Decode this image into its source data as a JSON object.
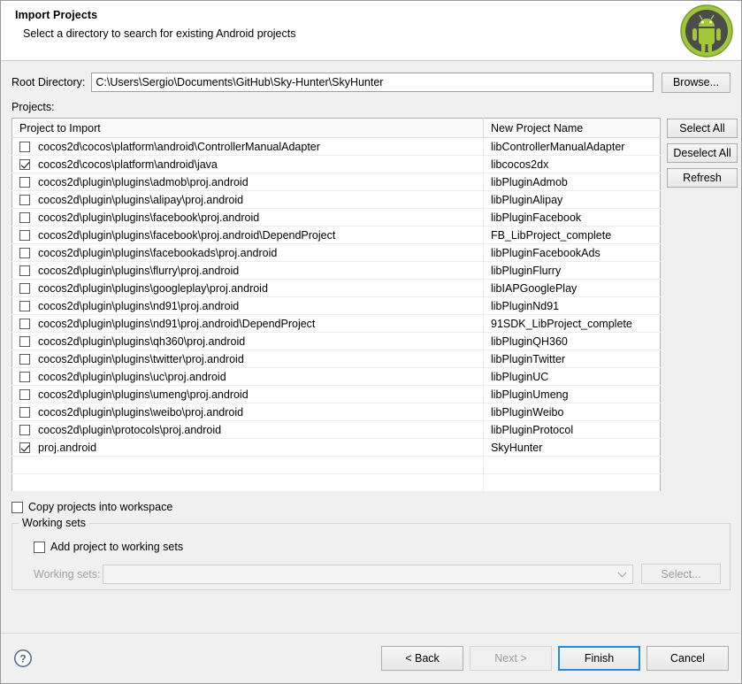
{
  "window": {
    "title": "Import Projects",
    "subtitle": "Select a directory to search for existing Android projects",
    "logo_icon": "android-robot-icon"
  },
  "root_directory": {
    "label": "Root Directory:",
    "value": "C:\\Users\\Sergio\\Documents\\GitHub\\Sky-Hunter\\SkyHunter",
    "placeholder": "",
    "browse_label": "Browse..."
  },
  "projects": {
    "section_label": "Projects:",
    "columns": [
      "Project to Import",
      "New Project Name"
    ],
    "rows": [
      {
        "checked": false,
        "path": "cocos2d\\cocos\\platform\\android\\ControllerManualAdapter",
        "name": "libControllerManualAdapter"
      },
      {
        "checked": true,
        "path": "cocos2d\\cocos\\platform\\android\\java",
        "name": "libcocos2dx"
      },
      {
        "checked": false,
        "path": "cocos2d\\plugin\\plugins\\admob\\proj.android",
        "name": "libPluginAdmob"
      },
      {
        "checked": false,
        "path": "cocos2d\\plugin\\plugins\\alipay\\proj.android",
        "name": "libPluginAlipay"
      },
      {
        "checked": false,
        "path": "cocos2d\\plugin\\plugins\\facebook\\proj.android",
        "name": "libPluginFacebook"
      },
      {
        "checked": false,
        "path": "cocos2d\\plugin\\plugins\\facebook\\proj.android\\DependProject",
        "name": "FB_LibProject_complete"
      },
      {
        "checked": false,
        "path": "cocos2d\\plugin\\plugins\\facebookads\\proj.android",
        "name": "libPluginFacebookAds"
      },
      {
        "checked": false,
        "path": "cocos2d\\plugin\\plugins\\flurry\\proj.android",
        "name": "libPluginFlurry"
      },
      {
        "checked": false,
        "path": "cocos2d\\plugin\\plugins\\googleplay\\proj.android",
        "name": "libIAPGooglePlay"
      },
      {
        "checked": false,
        "path": "cocos2d\\plugin\\plugins\\nd91\\proj.android",
        "name": "libPluginNd91"
      },
      {
        "checked": false,
        "path": "cocos2d\\plugin\\plugins\\nd91\\proj.android\\DependProject",
        "name": "91SDK_LibProject_complete"
      },
      {
        "checked": false,
        "path": "cocos2d\\plugin\\plugins\\qh360\\proj.android",
        "name": "libPluginQH360"
      },
      {
        "checked": false,
        "path": "cocos2d\\plugin\\plugins\\twitter\\proj.android",
        "name": "libPluginTwitter"
      },
      {
        "checked": false,
        "path": "cocos2d\\plugin\\plugins\\uc\\proj.android",
        "name": "libPluginUC"
      },
      {
        "checked": false,
        "path": "cocos2d\\plugin\\plugins\\umeng\\proj.android",
        "name": "libPluginUmeng"
      },
      {
        "checked": false,
        "path": "cocos2d\\plugin\\plugins\\weibo\\proj.android",
        "name": "libPluginWeibo"
      },
      {
        "checked": false,
        "path": "cocos2d\\plugin\\protocols\\proj.android",
        "name": "libPluginProtocol"
      },
      {
        "checked": true,
        "path": "proj.android",
        "name": "SkyHunter"
      },
      {
        "checked": null,
        "path": "",
        "name": ""
      },
      {
        "checked": null,
        "path": "",
        "name": ""
      }
    ],
    "side_buttons": [
      {
        "label": "Select All",
        "enabled": true
      },
      {
        "label": "Deselect All",
        "enabled": true
      },
      {
        "label": "Refresh",
        "enabled": true
      }
    ]
  },
  "options": {
    "copy_projects": {
      "label": "Copy projects into workspace",
      "checked": false
    }
  },
  "working_sets": {
    "legend": "Working sets",
    "add_checkbox": {
      "label": "Add project to working sets",
      "checked": false
    },
    "select_label": "Working sets:",
    "combo_value": "",
    "combo_icon": "chevron-down-icon",
    "select_button": {
      "label": "Select...",
      "enabled": false
    }
  },
  "footer": {
    "help_icon": "question-mark-icon",
    "buttons": [
      {
        "label": "< Back",
        "enabled": true,
        "focused": false
      },
      {
        "label": "Next >",
        "enabled": false,
        "focused": false
      },
      {
        "label": "Finish",
        "enabled": true,
        "focused": true
      },
      {
        "label": "Cancel",
        "enabled": true,
        "focused": false
      }
    ]
  },
  "colors": {
    "accent": "#1e90e0",
    "android_green": "#a4c639",
    "window_bg": "#f0f0f0",
    "header_bg": "#ffffff"
  }
}
